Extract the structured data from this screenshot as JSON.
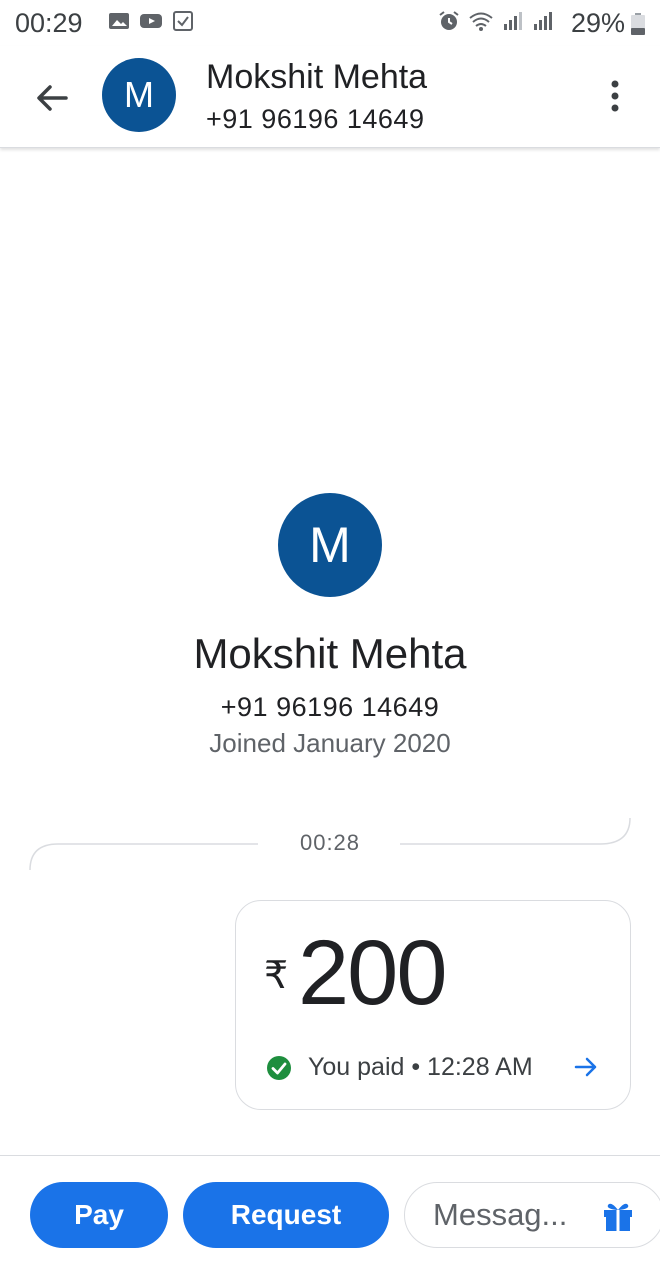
{
  "status_bar": {
    "time": "00:29",
    "battery": "29%",
    "left_icons": [
      "gallery-icon",
      "youtube-icon",
      "checkbox-icon"
    ],
    "right_icons": [
      "alarm-icon",
      "wifi-icon",
      "signal-icon",
      "signal-icon"
    ]
  },
  "header": {
    "avatar_letter": "M",
    "name": "Mokshit Mehta",
    "phone": "+91 96196 14649"
  },
  "profile": {
    "avatar_letter": "M",
    "name": "Mokshit Mehta",
    "phone": "+91 96196 14649",
    "joined": "Joined January 2020"
  },
  "conversation": {
    "timestamp": "00:28",
    "payment": {
      "currency": "₹",
      "amount": "200",
      "status": "You paid • 12:28 AM"
    }
  },
  "bottom_bar": {
    "pay_label": "Pay",
    "request_label": "Request",
    "message_placeholder": "Messag..."
  },
  "colors": {
    "avatar": "#0b5394",
    "primary_button": "#1a73e8",
    "success_check": "#1e8e3e",
    "arrow_blue": "#1a73e8"
  }
}
